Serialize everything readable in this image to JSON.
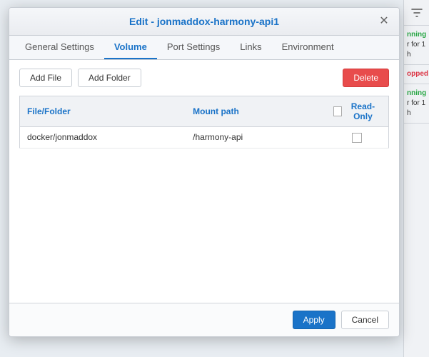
{
  "modal": {
    "title": "Edit - jonmaddox-harmony-api1",
    "close_label": "✕"
  },
  "tabs": [
    {
      "id": "general-settings",
      "label": "General Settings",
      "active": false
    },
    {
      "id": "volume",
      "label": "Volume",
      "active": true
    },
    {
      "id": "port-settings",
      "label": "Port Settings",
      "active": false
    },
    {
      "id": "links",
      "label": "Links",
      "active": false
    },
    {
      "id": "environment",
      "label": "Environment",
      "active": false
    }
  ],
  "toolbar": {
    "add_file_label": "Add File",
    "add_folder_label": "Add Folder",
    "delete_label": "Delete"
  },
  "table": {
    "col_file": "File/Folder",
    "col_mount": "Mount path",
    "col_readonly": "Read-Only",
    "rows": [
      {
        "file": "docker/jonmaddox",
        "mount": "/harmony-api",
        "readonly": false
      }
    ]
  },
  "footer": {
    "apply_label": "Apply",
    "cancel_label": "Cancel"
  },
  "sidebar": {
    "filter_icon": "⚡",
    "status_blocks": [
      {
        "label": "nning",
        "sub": "r for 1 h"
      },
      {
        "label": "opped",
        "sub": ""
      },
      {
        "label": "nning",
        "sub": "r for 1 h"
      }
    ]
  }
}
